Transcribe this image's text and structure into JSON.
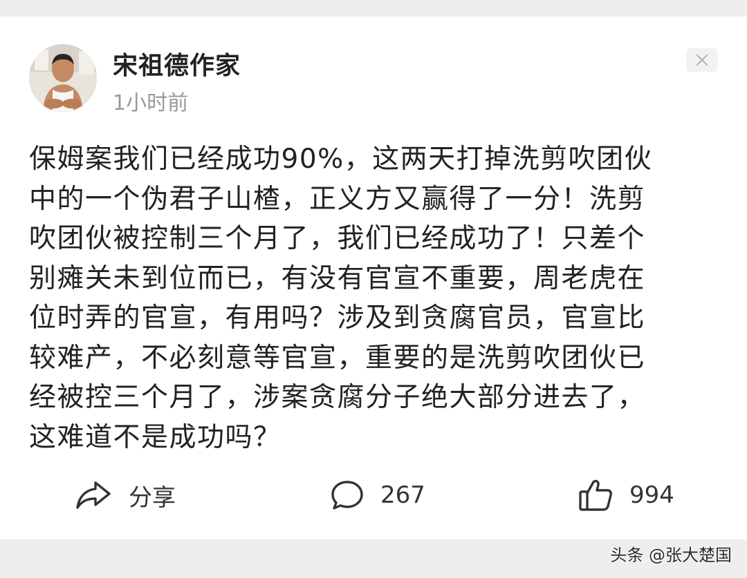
{
  "post": {
    "author": "宋祖德作家",
    "time": "1小时前",
    "text": "保姆案我们已经成功90%，这两天打掉洗剪吹团伙\n中的一个伪君子山楂，正义方又赢得了一分！洗剪\n吹团伙被控制三个月了，我们已经成功了！只差个\n别瘫关未到位而已，有没有官宣不重要，周老虎在\n位时弄的官宣，有用吗？涉及到贪腐官员，官宣比\n较难产，不必刻意等官宣，重要的是洗剪吹团伙已\n经被控三个月了，涉案贪腐分子绝大部分进去了，\n这难道不是成功吗？"
  },
  "actions": {
    "share_label": "分享",
    "comment_count": "267",
    "like_count": "994"
  },
  "icons": {
    "close": "close-icon",
    "share": "share-icon",
    "comment": "comment-icon",
    "like": "thumbs-up-icon"
  },
  "watermark": "头条 @张大楚国"
}
